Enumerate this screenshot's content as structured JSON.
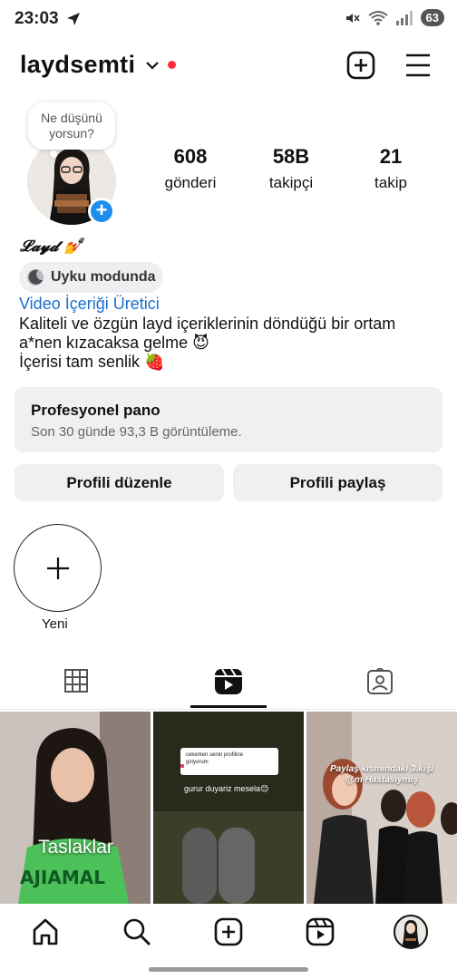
{
  "status_bar": {
    "time": "23:03",
    "battery": "63"
  },
  "header": {
    "username": "laydsemti"
  },
  "note": {
    "text_line1": "Ne düşünü",
    "text_line2": "yorsun?"
  },
  "stats": [
    {
      "value": "608",
      "label": "gönderi"
    },
    {
      "value": "58B",
      "label": "takipçi"
    },
    {
      "value": "21",
      "label": "takip"
    }
  ],
  "bio": {
    "name": "𝓛𝓪𝔂𝓭 💅",
    "status_chip": "Uyku modunda",
    "category": "Video İçeriği Üretici",
    "line1": "Kaliteli ve özgün layd içeriklerinin döndüğü bir ortam",
    "line2": "a*nen kızacaksa gelme 😈",
    "line3": "İçerisi tam senlik 🍓"
  },
  "pro_dashboard": {
    "title": "Profesyonel pano",
    "subtitle": "Son 30 günde 93,3 B görüntüleme."
  },
  "actions": {
    "edit_profile": "Profili düzenle",
    "share_profile": "Profili paylaş"
  },
  "highlights": {
    "new_label": "Yeni"
  },
  "tabs": [
    {
      "icon": "grid-icon"
    },
    {
      "icon": "reels-icon",
      "active": true
    },
    {
      "icon": "tagged-icon"
    }
  ],
  "grid_posts": [
    {
      "overlay_text": "Taslaklar"
    },
    {
      "caption_line1": "cekerken senin profiline",
      "caption_line2": "giriyorum",
      "caption_text": "gurur duyariz mesela😊"
    },
    {
      "caption_line1": "Paylaş kısmındaki 3.kişi",
      "caption_line2": "@m Hastasıymış"
    }
  ],
  "bottom_nav": [
    "home-icon",
    "search-icon",
    "create-icon",
    "reels-icon",
    "profile-avatar"
  ]
}
